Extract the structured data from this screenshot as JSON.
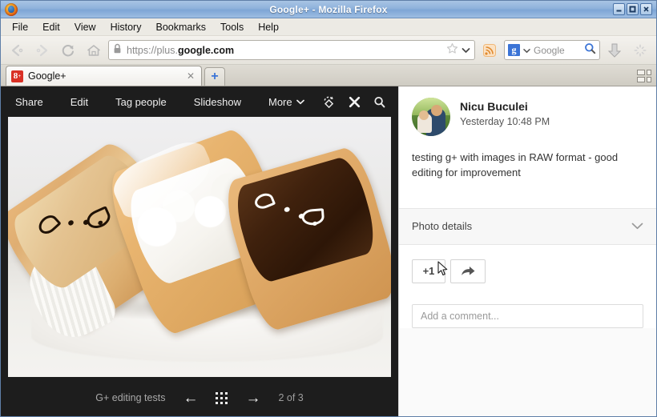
{
  "window": {
    "title": "Google+ - Mozilla Firefox",
    "minimize_label": "minimize",
    "maximize_label": "maximize",
    "close_label": "close"
  },
  "menubar": {
    "items": [
      {
        "label": "File",
        "accesskey": "F"
      },
      {
        "label": "Edit",
        "accesskey": "E"
      },
      {
        "label": "View",
        "accesskey": "V"
      },
      {
        "label": "History",
        "accesskey": "s"
      },
      {
        "label": "Bookmarks",
        "accesskey": "B"
      },
      {
        "label": "Tools",
        "accesskey": "T"
      },
      {
        "label": "Help",
        "accesskey": "H"
      }
    ]
  },
  "navbar": {
    "back_icon": "back-arrow-icon",
    "forward_icon": "forward-arrow-icon",
    "reload_icon": "reload-icon",
    "home_icon": "home-icon",
    "lock_icon": "padlock-icon",
    "url_scheme": "https://plus.",
    "url_domain": "google.com",
    "url_full": "https://plus.google.com",
    "bookmark_icon": "star-icon",
    "dropdown_icon": "chevron-down-icon",
    "feed_icon": "rss-feed-icon",
    "search_engine": "Google",
    "search_engine_badge": "g",
    "search_placeholder": "Google",
    "search_icon": "magnifier-icon",
    "downloads_icon": "download-arrow-icon",
    "throbber_icon": "loading-spinner-icon"
  },
  "tabbar": {
    "tab_title": "Google+",
    "tab_favicon": "google-plus-favicon",
    "close_label": "✕",
    "newtab_label": "+",
    "list_all_tabs_icon": "list-all-tabs-icon"
  },
  "viewer": {
    "toolbar": [
      {
        "label": "Share",
        "name": "share"
      },
      {
        "label": "Edit",
        "name": "edit"
      },
      {
        "label": "Tag people",
        "name": "tag-people"
      },
      {
        "label": "Slideshow",
        "name": "slideshow"
      },
      {
        "label": "More",
        "name": "more"
      }
    ],
    "more_caret": "⌄",
    "icons": [
      {
        "name": "rotate-icon"
      },
      {
        "name": "close-icon"
      },
      {
        "name": "zoom-icon"
      }
    ],
    "album_name": "G+ editing tests",
    "prev_arrow": "←",
    "next_arrow": "→",
    "grid_icon": "grid-view-icon",
    "counter": "2 of 3",
    "photo_alt": "three eclairs on a white doily"
  },
  "panel": {
    "author": "Nicu Buculei",
    "timestamp": "Yesterday 10:48 PM",
    "post_text": "testing g+ with images in RAW format - good editing for improvement",
    "details_label": "Photo details",
    "details_chevron": "chevron-down-icon",
    "plusone_label": "+1",
    "share_icon": "share-arrow-icon",
    "comment_placeholder": "Add a comment..."
  },
  "colors": {
    "titlebar_blue": "#8fb2db",
    "viewer_dark": "#1d1d1d",
    "gplus_red": "#d93025",
    "google_blue": "#3b74d6",
    "panel_white": "#ffffff"
  }
}
